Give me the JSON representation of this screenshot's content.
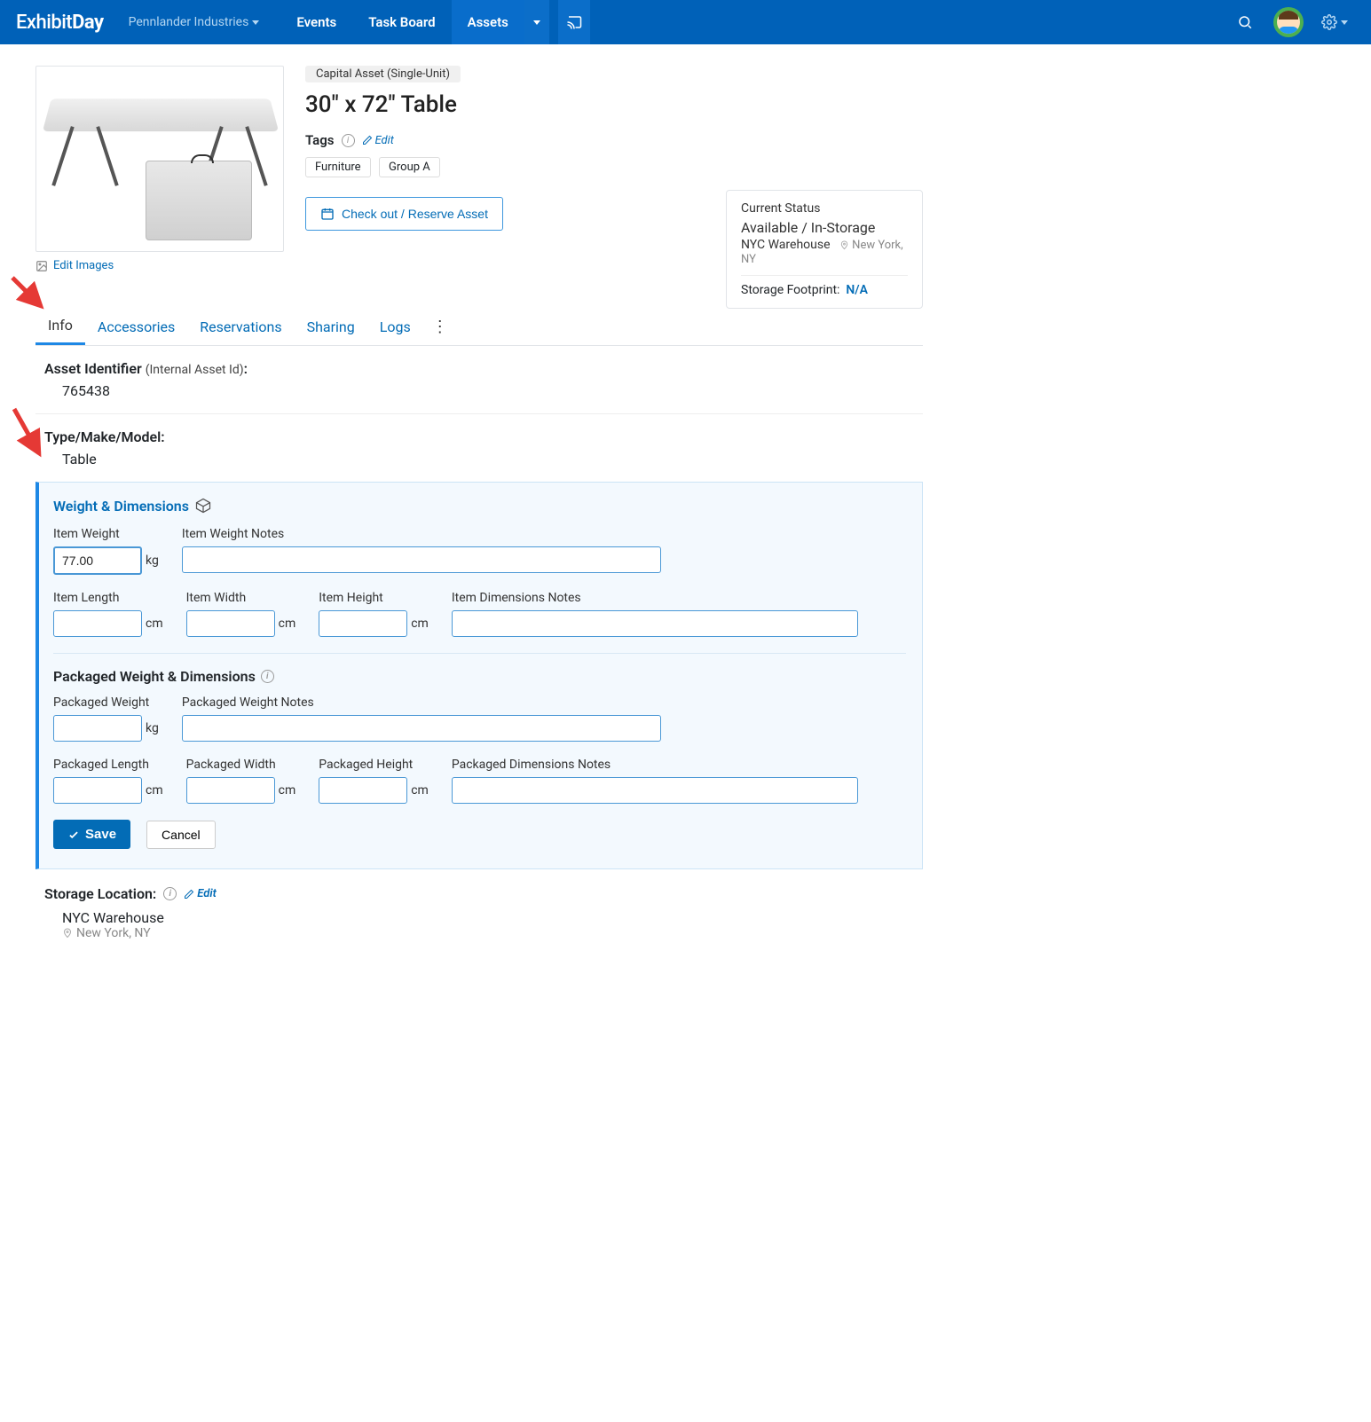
{
  "nav": {
    "logo_prefix": "Exhibit",
    "logo_suffix": "Day",
    "workspace": "Pennlander Industries",
    "items": [
      "Events",
      "Task Board",
      "Assets"
    ]
  },
  "asset": {
    "edit_images": "Edit Images",
    "badge": "Capital Asset (Single-Unit)",
    "title": "30\" x 72\" Table",
    "tags_label": "Tags",
    "tags_edit": "Edit",
    "tags": [
      "Furniture",
      "Group A"
    ],
    "checkout_btn": "Check out / Reserve Asset"
  },
  "status": {
    "label": "Current Status",
    "value": "Available / In-Storage",
    "warehouse": "NYC Warehouse",
    "city": "New York, NY",
    "footprint_label": "Storage Footprint:",
    "footprint_value": "N/A"
  },
  "tabs": [
    "Info",
    "Accessories",
    "Reservations",
    "Sharing",
    "Logs"
  ],
  "info": {
    "identifier_label": "Asset Identifier",
    "identifier_sub": "(Internal Asset Id)",
    "identifier_value": "765438",
    "type_label": "Type/Make/Model:",
    "type_value": "Table"
  },
  "wd": {
    "title": "Weight & Dimensions",
    "item_weight_label": "Item Weight",
    "item_weight_value": "77.00",
    "item_weight_unit": "kg",
    "item_weight_notes_label": "Item Weight Notes",
    "item_length_label": "Item Length",
    "item_width_label": "Item Width",
    "item_height_label": "Item Height",
    "length_unit": "cm",
    "item_dim_notes_label": "Item Dimensions Notes",
    "packaged_header": "Packaged Weight & Dimensions",
    "pkg_weight_label": "Packaged Weight",
    "pkg_weight_unit": "kg",
    "pkg_weight_notes_label": "Packaged Weight Notes",
    "pkg_length_label": "Packaged Length",
    "pkg_width_label": "Packaged Width",
    "pkg_height_label": "Packaged Height",
    "pkg_dim_notes_label": "Packaged Dimensions Notes",
    "save": "Save",
    "cancel": "Cancel"
  },
  "storage": {
    "label": "Storage Location:",
    "edit": "Edit",
    "value": "NYC Warehouse",
    "city": "New York, NY"
  }
}
